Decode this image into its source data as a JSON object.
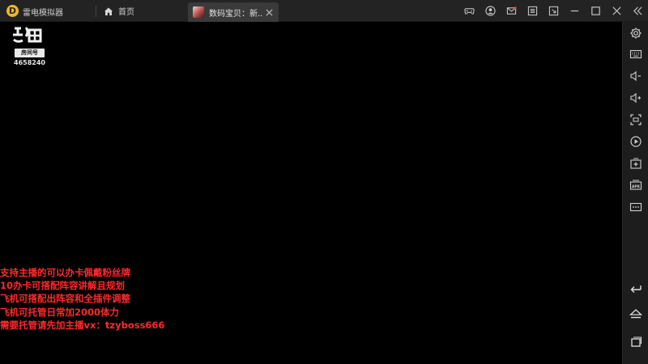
{
  "app": {
    "name": "雷电模拟器",
    "logo_letter": "D"
  },
  "tabs": [
    {
      "label": "首页",
      "icon": "home-icon"
    },
    {
      "label": "数码宝贝：新...",
      "icon": "game-icon",
      "active": true
    }
  ],
  "titlebar_icons": [
    "gamepad-icon",
    "user-icon",
    "mail-icon",
    "settings-icon",
    "fullscreen-exit-icon",
    "minimize-icon",
    "maximize-icon",
    "close-icon",
    "collapse-sidebar-icon"
  ],
  "sidebar_icons": [
    "settings-gear-icon",
    "keyboard-icon",
    "volume-down-icon",
    "volume-up-icon",
    "screenshot-icon",
    "record-icon",
    "add-apk-icon",
    "apk-install-icon",
    "more-icon",
    "back-icon",
    "home-icon",
    "recent-apps-icon"
  ],
  "watermark": {
    "badge": "房间号",
    "room_id": "4658240"
  },
  "notice": {
    "lines": [
      "支持主播的可以办卡佩戴粉丝牌",
      "10办卡可搭配阵容讲解且规划",
      "飞机可搭配出阵容和全插件调整",
      "飞机可托管日常加2000体力",
      "需要托管请先加主播vx：tzyboss666"
    ]
  },
  "colors": {
    "titlebar_bg": "#232323",
    "sidebar_bg": "#1d1d1d",
    "screen_bg": "#000000",
    "notice_text": "#ff2a2a",
    "logo_yellow": "#f2b824"
  }
}
